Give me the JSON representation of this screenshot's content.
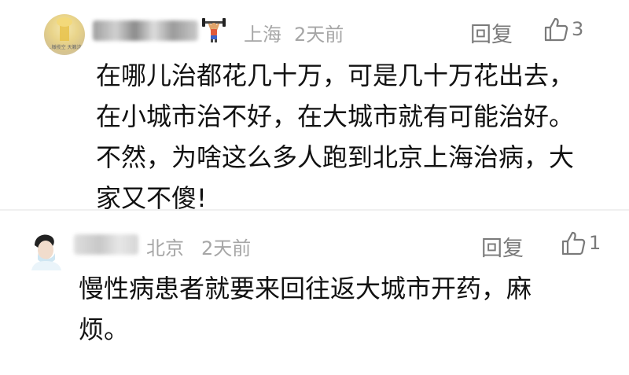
{
  "comments": [
    {
      "avatar_caption": "...橄榄空 天籁流声",
      "badge_icon": "weightlifter-icon",
      "location": "上海",
      "time": "2天前",
      "reply_label": "回复",
      "like_count": "3",
      "text_lines": [
        "在哪儿治都花几十万，可是几十万花出去，",
        "在小城市治不好，在大城市就有可能治好。",
        "不然，为啥这么多人跑到北京上海治病，大",
        "家又不傻!"
      ]
    },
    {
      "location": "北京",
      "time": "2天前",
      "reply_label": "回复",
      "like_count": "1",
      "text_lines": [
        "慢性病患者就要来回往返大城市开药，麻",
        "烦。"
      ]
    }
  ],
  "colors": {
    "meta": "#a6a6a6",
    "action": "#7a7a7a",
    "body": "#111111"
  }
}
